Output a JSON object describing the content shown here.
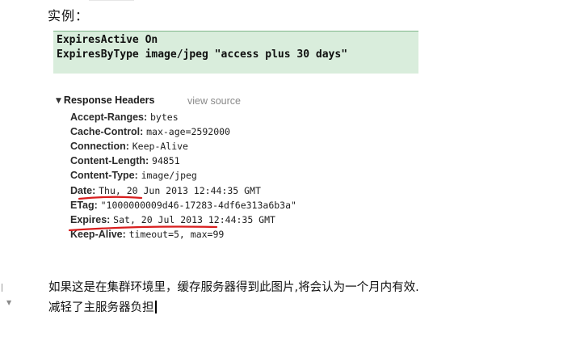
{
  "heading": "实例：",
  "code": {
    "line1": "ExpiresActive On",
    "line2": "ExpiresByType image/jpeg \"access plus 30 days\""
  },
  "panel": {
    "toggle_icon": "disclosure-triangle-down",
    "title": "Response Headers",
    "view_source": "view source"
  },
  "headers": [
    {
      "key": "Accept-Ranges:",
      "value": "bytes"
    },
    {
      "key": "Cache-Control:",
      "value": "max-age=2592000"
    },
    {
      "key": "Connection:",
      "value": "Keep-Alive"
    },
    {
      "key": "Content-Length:",
      "value": "94851"
    },
    {
      "key": "Content-Type:",
      "value": "image/jpeg"
    },
    {
      "key": "Date:",
      "value": "Thu, 20 Jun 2013 12:44:35 GMT"
    },
    {
      "key": "ETag:",
      "value": "\"1000000009d46-17283-4df6e313a6b3a\""
    },
    {
      "key": "Expires:",
      "value": "Sat, 20 Jul 2013 12:44:35 GMT"
    },
    {
      "key": "Keep-Alive:",
      "value": "timeout=5, max=99"
    }
  ],
  "notes": {
    "line1": "如果这是在集群环境里，缓存服务器得到此图片,将会认为一个月内有效.",
    "line2": "减轻了主服务器负担"
  },
  "colors": {
    "code_bg": "#d9eddc",
    "underline": "#d81e1e"
  }
}
